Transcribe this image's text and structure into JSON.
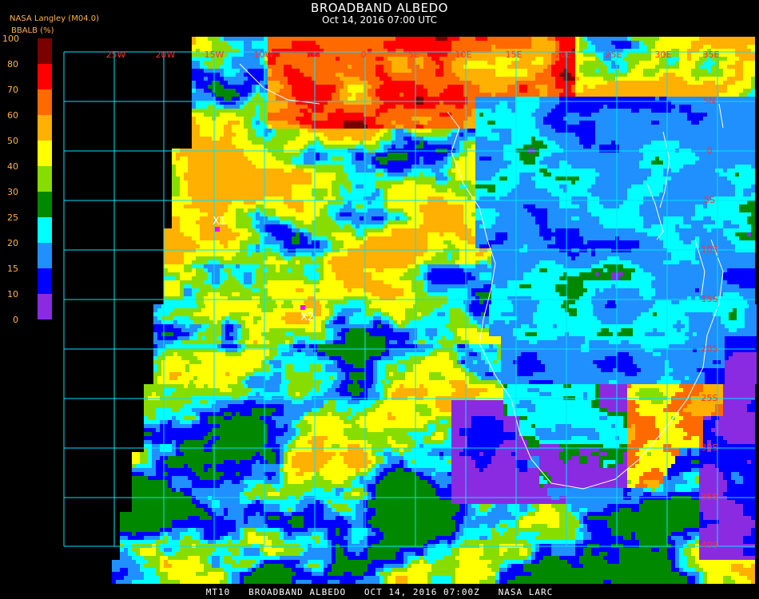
{
  "header": {
    "title": "BROADBAND ALBEDO",
    "subtitle": "Oct 14, 2016 07:00 UTC",
    "source": "NASA Langley (M04.0)",
    "unit_label": "BBALB (%)"
  },
  "legend": {
    "ticks": [
      "100",
      "80",
      "70",
      "60",
      "50",
      "40",
      "30",
      "25",
      "20",
      "15",
      "10",
      "0"
    ],
    "bins": [
      {
        "range": "80-100",
        "color": "#7a0000"
      },
      {
        "range": "70-80",
        "color": "#ff0000"
      },
      {
        "range": "60-70",
        "color": "#ff6a00"
      },
      {
        "range": "50-60",
        "color": "#ffb000"
      },
      {
        "range": "40-50",
        "color": "#ffff00"
      },
      {
        "range": "30-40",
        "color": "#88dd00"
      },
      {
        "range": "25-30",
        "color": "#008800"
      },
      {
        "range": "20-25",
        "color": "#00ffff"
      },
      {
        "range": "15-20",
        "color": "#2090ff"
      },
      {
        "range": "10-15",
        "color": "#0000ff"
      },
      {
        "range": "0-10",
        "color": "#8a2be2"
      }
    ]
  },
  "map": {
    "longitude_labels": [
      "25W",
      "20W",
      "15W",
      "10W",
      "5W",
      "0",
      "5E",
      "10E",
      "15E",
      "20E",
      "25E",
      "30E",
      "35E"
    ],
    "latitude_labels": [
      "5N",
      "0",
      "5S",
      "10S",
      "15S",
      "20S",
      "25S",
      "30S",
      "35S",
      "40S"
    ],
    "markers": [
      {
        "label": "X1",
        "color": "#ff00ff"
      },
      {
        "label": "X2",
        "color": "#ff00ff"
      }
    ],
    "colors": {
      "grid": "#00e5ff",
      "coast": "#ffffff",
      "background": "#000000",
      "labels": "#ff3030"
    }
  },
  "footer": "MT10   BROADBAND ALBEDO   OCT 14, 2016 07:00Z   NASA LARC"
}
